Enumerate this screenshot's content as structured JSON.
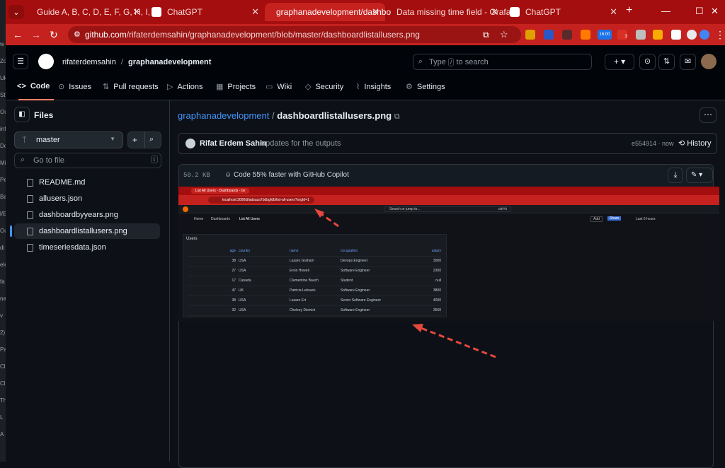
{
  "left_strip": [
    "w",
    "Zo",
    "Uk",
    "St",
    "Ou",
    "inf",
    "Do",
    "Mi",
    "Pe",
    "Ba",
    "l/E",
    "Oc",
    "di",
    "ele",
    "fa",
    "na",
    "v",
    "2)",
    "Pa",
    "Cl",
    "Cl",
    "Th",
    "L",
    "A"
  ],
  "browser": {
    "tabs": [
      {
        "title": "Guide A, B, C, D, E, F, G, H, I, J,",
        "color": "#4f7cff"
      },
      {
        "title": "ChatGPT",
        "color": "#ffffff"
      },
      {
        "title": "graphanadevelopment/dashbo",
        "color": "#ffffff"
      },
      {
        "title": "Data missing time field - Grafa",
        "color": "#f46800"
      },
      {
        "title": "ChatGPT",
        "color": "#ffffff"
      }
    ],
    "new_tab": "+",
    "url": "github.com/rifaterdemsahin/graphanadevelopment/blob/master/dashboardlistallusers.png",
    "url_host": "github.com",
    "url_path": "/rifaterdemsahin/graphanadevelopment/blob/master/dashboardlistallusers.png",
    "ext_badge": "16:00",
    "ext_count": "3"
  },
  "github": {
    "owner": "rifaterdemsahin",
    "repo": "graphanadevelopment",
    "separator": "/",
    "search_prefix": "Type",
    "search_key": "/",
    "search_suffix": "to search",
    "nav": [
      {
        "label": "Code",
        "icon": "<>"
      },
      {
        "label": "Issues",
        "icon": "⊙"
      },
      {
        "label": "Pull requests",
        "icon": "⇅"
      },
      {
        "label": "Actions",
        "icon": "▷"
      },
      {
        "label": "Projects",
        "icon": "▦"
      },
      {
        "label": "Wiki",
        "icon": "▭"
      },
      {
        "label": "Security",
        "icon": "◇"
      },
      {
        "label": "Insights",
        "icon": "⌇"
      },
      {
        "label": "Settings",
        "icon": "⚙"
      }
    ]
  },
  "sidebar": {
    "title": "Files",
    "branch": "master",
    "goto_placeholder": "Go to file",
    "goto_key": "t",
    "files": [
      "README.md",
      "allusers.json",
      "dashboardbyyears.png",
      "dashboardlistallusers.png",
      "timeseriesdata.json"
    ],
    "selected_index": 3
  },
  "main": {
    "breadcrumb_repo": "graphanadevelopment",
    "breadcrumb_sep": "/",
    "filename": "dashboardlistallusers.png",
    "commit_author": "Rifat Erdem Sahin",
    "commit_message": "updates for the outputs",
    "commit_meta": "e554914 · now",
    "history": "History",
    "file_size": "50.2 KB",
    "copilot": "Code 55% faster with GitHub Copilot"
  },
  "screenshot": {
    "tab_title": "List All Users - Dashboards - Gr",
    "url": "localhost:3000/d/adsuza7bdbgfdb/list-all-users?orgId=1",
    "search": "Search or jump to...",
    "search_key": "ctrl+k",
    "breadcrumb": [
      "Home",
      "Dashboards",
      "List All Users"
    ],
    "add": "Add",
    "share": "Share",
    "time_range": "Last 6 hours",
    "panel_title": "Users",
    "columns": [
      "age",
      "country",
      "name",
      "occupation",
      "salary"
    ],
    "rows": [
      [
        "38",
        "USA",
        "Lazaro Graham",
        "Devops Engineer",
        "3000"
      ],
      [
        "27",
        "USA",
        "Ervin Howell",
        "Software Engineer",
        "2300"
      ],
      [
        "17",
        "Canada",
        "Clementine Bauch",
        "Student",
        "null"
      ],
      [
        "47",
        "UK",
        "Patricia Lebsack",
        "Software Engineer",
        "3800"
      ],
      [
        "38",
        "USA",
        "Lazaro Ert",
        "Senior Software Engineer",
        "4000"
      ],
      [
        "32",
        "USA",
        "Chelsey Dietrich",
        "Software Engineer",
        "3500"
      ]
    ]
  },
  "colors": {
    "accent": "#f78166",
    "link": "#4493f8",
    "chrome_red": "#c5221f",
    "arrow": "#e5483d"
  }
}
